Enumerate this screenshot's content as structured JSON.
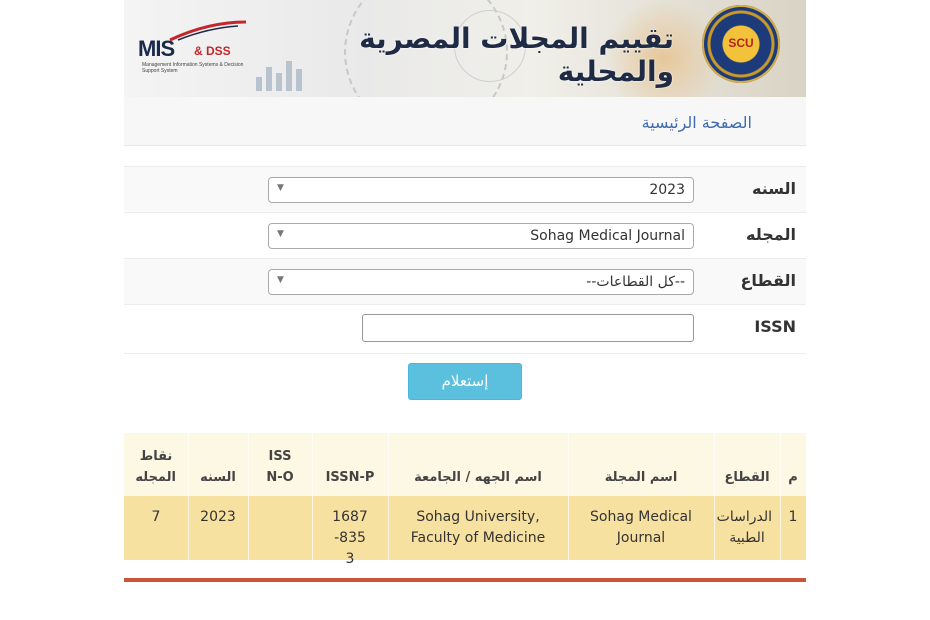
{
  "banner": {
    "title": "تقييم المجلات المصرية والمحلية",
    "left_logo_text": "MIS",
    "left_logo_suffix": "& DSS",
    "left_logo_subtitle": "Management Information Systems & Decision Support System",
    "right_logo_text": "SCU"
  },
  "breadcrumb": {
    "home": "الصفحة الرئيسية"
  },
  "form": {
    "year_label": "السنه",
    "year_value": "2023",
    "journal_label": "المجله",
    "journal_value": "Sohag Medical Journal",
    "sector_label": "القطاع",
    "sector_value": "--كل القطاعات--",
    "issn_label": "ISSN",
    "issn_value": ""
  },
  "query_button": "إستعلام",
  "results": {
    "headers": {
      "num": "م",
      "sector": "القطاع",
      "journal_name": "اسم المجلة",
      "org_name": "اسم الجهه / الجامعة",
      "issn_p": "ISSN-P",
      "issn_o": "ISSN-O",
      "year": "السنه",
      "points": "نقاط المجله"
    },
    "rows": [
      {
        "num": "1",
        "sector": "الدراسات الطبية",
        "journal_name": "Sohag Medical Journal",
        "org_name": "Sohag University, Faculty of Medicine",
        "issn_p": "1687-8353",
        "issn_o": "",
        "year": "2023",
        "points": "7"
      }
    ]
  },
  "colors": {
    "link_blue": "#3e6bb0",
    "button_info": "#5bc0de",
    "table_header_bg": "#fcf8e3",
    "table_row_bg": "#f7e1a1",
    "bottom_rule": "#c9553a"
  }
}
